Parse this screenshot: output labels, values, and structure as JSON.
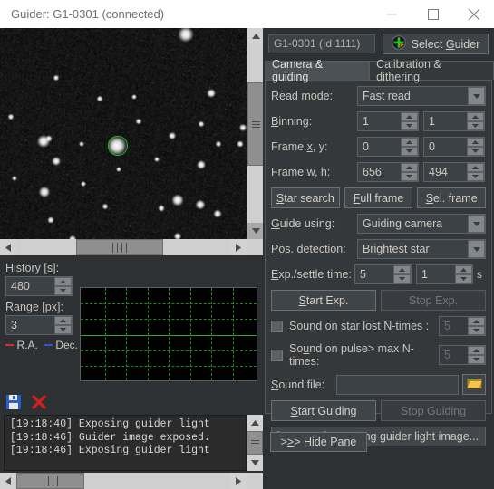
{
  "window": {
    "title": "Guider: G1-0301 (connected)",
    "controls": [
      {
        "name": "minimize",
        "glyph": "minimize-icon"
      },
      {
        "name": "maximize",
        "glyph": "maximize-icon"
      },
      {
        "name": "close",
        "glyph": "close-icon"
      }
    ]
  },
  "image_view": {
    "guide_star_marker": "green-circle",
    "vscroll": "vertical-scrollbar",
    "hscroll": "horizontal-scrollbar"
  },
  "history": {
    "history_label": "History [s]:",
    "history_value": "480",
    "range_label": "Range [px]:",
    "range_value": "3",
    "legend_ra": "R.A.",
    "legend_dec": "Dec.",
    "color_ra": "#e02b2b",
    "color_dec": "#2b55e0",
    "grid_color": "#1d8c1d"
  },
  "log": {
    "save_icon": "save-icon",
    "clear_icon": "clear-icon",
    "lines": [
      "[19:18:40] Exposing guider light",
      "[19:18:46] Guider image exposed.",
      "[19:18:46] Exposing guider light"
    ]
  },
  "guider": {
    "name_field": "G1-0301 (Id 1111)",
    "select_button": "Select Guider",
    "select_button_prefix": "Select ",
    "select_button_accel": "G",
    "select_button_suffix": "uider"
  },
  "tabs": [
    {
      "label": "Camera & guiding",
      "active": true
    },
    {
      "label": "Calibration & dithering",
      "active": false
    }
  ],
  "camera_panel": {
    "read_mode": {
      "label_pre": "Read ",
      "label_accel": "m",
      "label_post": "ode:",
      "value": "Fast read"
    },
    "binning": {
      "label_accel": "B",
      "label_post": "inning:",
      "x": "1",
      "y": "1"
    },
    "frame_xy": {
      "label_pre": "Frame ",
      "label_accel": "x",
      "label_post": ", y:",
      "x": "0",
      "y": "0"
    },
    "frame_wh": {
      "label_pre": "Frame ",
      "label_accel": "w",
      "label_post": ", h:",
      "w": "656",
      "h": "494"
    },
    "buttons": [
      {
        "pre": "",
        "accel": "S",
        "post": "tar search"
      },
      {
        "pre": "",
        "accel": "F",
        "post": "ull frame"
      },
      {
        "pre": "",
        "accel": "S",
        "post": "el. frame"
      }
    ],
    "guide_using": {
      "label_accel": "G",
      "label_post": "uide using:",
      "value": "Guiding camera"
    },
    "pos_detection": {
      "label_accel": "P",
      "label_post": "os. detection:",
      "value": "Brightest star"
    },
    "exp_settle": {
      "label_accel": "E",
      "label_post": "xp./settle time:",
      "exposure": "5",
      "settle": "1",
      "unit": "s"
    },
    "start_exp": {
      "pre": "",
      "accel": "S",
      "post": "tart Exp."
    },
    "stop_exp": {
      "label": "Stop Exp.",
      "enabled": false
    },
    "sound_star_lost": {
      "pre": "",
      "accel": "S",
      "post": "ound on star lost N-times :",
      "checked": false,
      "value": "5"
    },
    "sound_pulse_max": {
      "pre": "So",
      "accel": "u",
      "post": "nd on pulse> max N-times:",
      "checked": false,
      "value": "5"
    },
    "sound_file": {
      "label_accel": "S",
      "label_post": "ound file:",
      "value": "",
      "browse_icon": "folder-icon"
    },
    "start_guiding": {
      "pre": "",
      "accel": "S",
      "post": "tart Guiding"
    },
    "stop_guiding": {
      "label": "Stop Guiding",
      "enabled": false
    },
    "status": "[19:18:46] Exposing guider light image..."
  },
  "hide_pane": {
    "pre": ">",
    "accel": ">",
    "post": "> Hide Pane"
  }
}
